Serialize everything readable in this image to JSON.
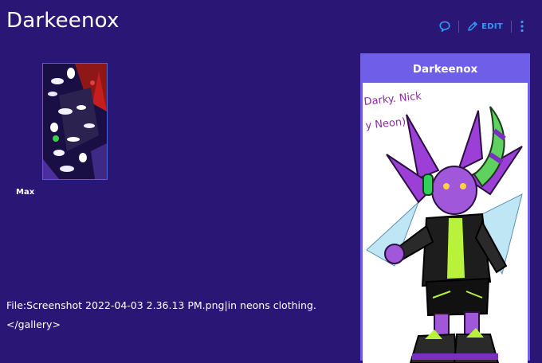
{
  "page": {
    "title": "Darkeenox"
  },
  "toolbar": {
    "edit_label": "EDIT"
  },
  "gallery": {
    "caption": "Max"
  },
  "body": {
    "line1": "File:Screenshot 2022-04-03 2.36.13 PM.png|in neons clothing.",
    "line2": "</gallery>"
  },
  "infobox": {
    "title": "Darkeenox",
    "image_caption_text": "Darky. Nick… (y Neon)"
  },
  "colors": {
    "background": "#2a1775",
    "accent": "#2d9cf7",
    "infobox_header": "#6f5ee8"
  },
  "icons": [
    "comment-icon",
    "pencil-icon",
    "more-vertical-icon"
  ]
}
